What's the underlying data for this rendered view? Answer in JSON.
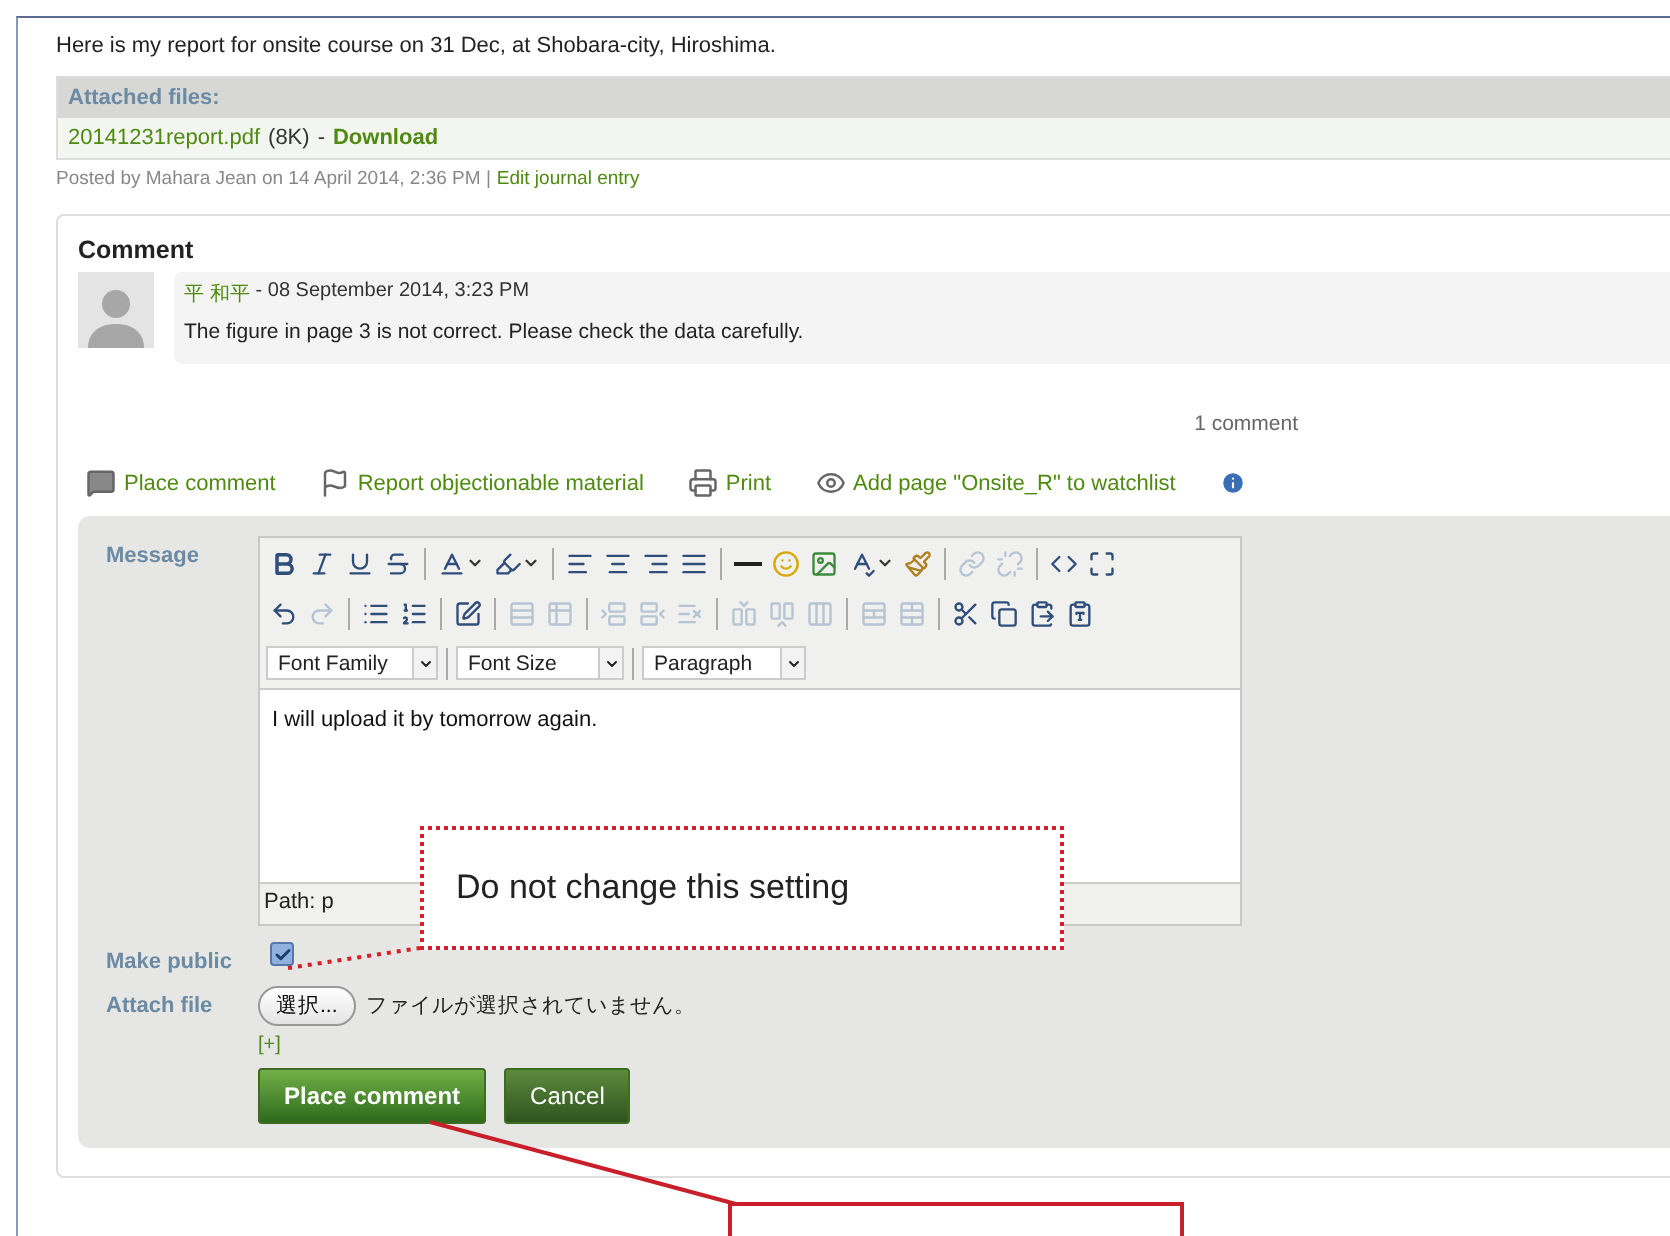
{
  "intro": "Here is my report for onsite course on 31 Dec, at Shobara-city, Hiroshima.",
  "attachments": {
    "heading": "Attached files:",
    "files": [
      {
        "name": "20141231report.pdf",
        "size": "(8K)",
        "separator": "-",
        "action": "Download"
      }
    ]
  },
  "post_meta": {
    "text": "Posted by Mahara Jean on 14 April 2014, 2:36 PM |",
    "link": "Edit journal entry"
  },
  "comments": {
    "heading": "Comment",
    "items": [
      {
        "author": "平 和平",
        "date": "- 08 September 2014, 3:23 PM",
        "body": "The figure in page 3 is not correct. Please check the data carefully."
      }
    ],
    "count": "1 comment"
  },
  "actions": [
    {
      "kind": "comment",
      "label": "Place comment"
    },
    {
      "kind": "report",
      "label": "Report objectionable material"
    },
    {
      "kind": "print",
      "label": "Print"
    },
    {
      "kind": "watch",
      "label": "Add page \"Onsite_R\" to watchlist"
    },
    {
      "kind": "info"
    }
  ],
  "form": {
    "message_label": "Message",
    "toolbar": [
      [
        {
          "kind": "bold",
          "disabled": false
        },
        {
          "kind": "italic",
          "disabled": false
        },
        {
          "kind": "underline",
          "disabled": false
        },
        {
          "kind": "strike",
          "disabled": false
        },
        {
          "kind": "separator"
        },
        {
          "kind": "forecolor",
          "disabled": false,
          "menu": true
        },
        {
          "kind": "backcolor",
          "disabled": false,
          "menu": true
        },
        {
          "kind": "separator"
        },
        {
          "kind": "alignleft",
          "disabled": false
        },
        {
          "kind": "aligncenter",
          "disabled": false
        },
        {
          "kind": "alignright",
          "disabled": false
        },
        {
          "kind": "alignjustify",
          "disabled": false
        },
        {
          "kind": "separator"
        },
        {
          "kind": "hr",
          "disabled": false
        },
        {
          "kind": "emoticon",
          "disabled": false
        },
        {
          "kind": "image",
          "disabled": false
        },
        {
          "kind": "spellcheck",
          "disabled": false,
          "menu": true
        },
        {
          "kind": "cleanup",
          "disabled": false
        },
        {
          "kind": "separator"
        },
        {
          "kind": "link",
          "disabled": true
        },
        {
          "kind": "unlink",
          "disabled": true
        },
        {
          "kind": "separator"
        },
        {
          "kind": "html",
          "disabled": false
        },
        {
          "kind": "fullscreen",
          "disabled": false
        }
      ],
      [
        {
          "kind": "undo",
          "disabled": false
        },
        {
          "kind": "redo",
          "disabled": true
        },
        {
          "kind": "separator"
        },
        {
          "kind": "bullist",
          "disabled": false
        },
        {
          "kind": "numlist",
          "disabled": false
        },
        {
          "kind": "separator"
        },
        {
          "kind": "edit",
          "disabled": false
        },
        {
          "kind": "separator"
        },
        {
          "kind": "rowprops",
          "disabled": true
        },
        {
          "kind": "cellprops",
          "disabled": true
        },
        {
          "kind": "separator"
        },
        {
          "kind": "rowbefore",
          "disabled": true
        },
        {
          "kind": "rowafter",
          "disabled": true
        },
        {
          "kind": "deleterow",
          "disabled": true
        },
        {
          "kind": "separator"
        },
        {
          "kind": "colbefore",
          "disabled": true
        },
        {
          "kind": "colafter",
          "disabled": true
        },
        {
          "kind": "deletecol",
          "disabled": true
        },
        {
          "kind": "separator"
        },
        {
          "kind": "splitcells",
          "disabled": true
        },
        {
          "kind": "mergecells",
          "disabled": true
        },
        {
          "kind": "separator"
        },
        {
          "kind": "cut",
          "disabled": false
        },
        {
          "kind": "copy",
          "disabled": false
        },
        {
          "kind": "paste",
          "disabled": false
        },
        {
          "kind": "pasteword",
          "disabled": false
        }
      ]
    ],
    "dropdowns": [
      {
        "value": "Font Family"
      },
      {
        "value": "Font Size"
      },
      {
        "value": "Paragraph"
      }
    ],
    "message_value": "I will upload it by tomorrow again.",
    "path": "Path: p",
    "make_public": {
      "label": "Make public",
      "checked": true
    },
    "attach": {
      "label": "Attach file",
      "button": "選択...",
      "status": "ファイルが選択されていません。",
      "add_more": "[+]"
    },
    "buttons": [
      {
        "kind": "primary",
        "label": "Place comment"
      },
      {
        "kind": "secondary",
        "label": "Cancel"
      }
    ]
  },
  "annotations": [
    {
      "kind": "callout",
      "text": "Do not change this setting"
    },
    {
      "kind": "empty_box"
    }
  ]
}
